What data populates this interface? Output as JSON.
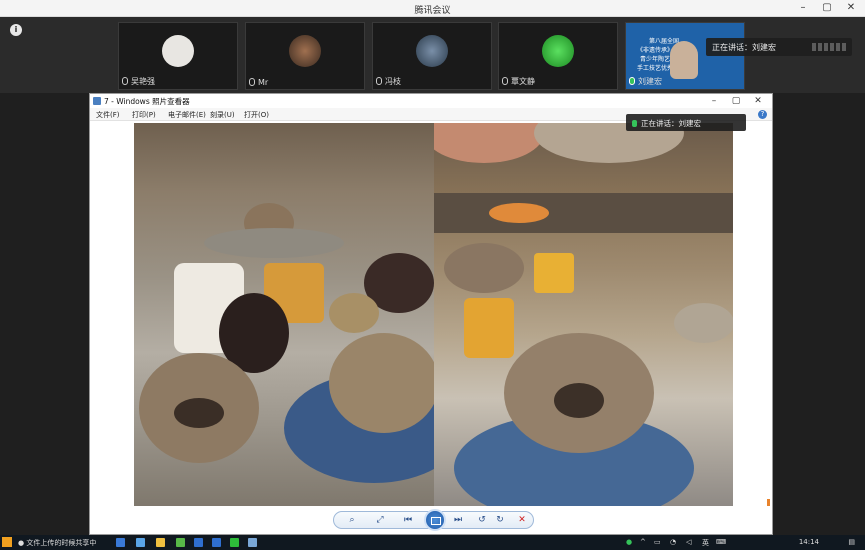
{
  "meeting": {
    "title": "腾讯会议"
  },
  "participants": [
    {
      "name": "吴艳强",
      "avatar_color": "#e8e6e2"
    },
    {
      "name": "Mr",
      "avatar_color": "#6b4a3a"
    },
    {
      "name": "冯枝",
      "avatar_color": "#45607a"
    },
    {
      "name": "覃文静",
      "avatar_color": "#2fae35"
    },
    {
      "name": "刘建宏",
      "active": true,
      "text_lines": [
        "第八届全国",
        "《非遗传承》等教育",
        "青少年陶艺与传统",
        "手工技艺优秀交流会"
      ]
    }
  ],
  "speaker_banner": "正在讲话：刘建宏",
  "viewer": {
    "title": "7 - Windows 照片查看器",
    "menu": [
      "文件(F)",
      "打印(P)",
      "电子邮件(E)",
      "刻录(U)",
      "打开(O)"
    ],
    "speaking_label": "正在讲话：刘建宏"
  },
  "toolbar": {
    "buttons": [
      "zoom",
      "fit",
      "prev",
      "slideshow",
      "next",
      "rotate-left",
      "rotate-right",
      "delete"
    ]
  },
  "taskbar": {
    "task_label": "文件上传的时候共享中",
    "lang": "英",
    "time": "14:14"
  },
  "colors": {
    "accent": "#1f62a8",
    "speaking_green": "#35c35a",
    "taskbar": "#101820"
  }
}
